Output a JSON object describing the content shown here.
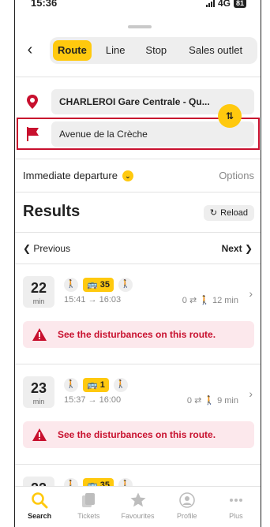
{
  "status": {
    "time": "15:36",
    "network": "4G",
    "battery": "81"
  },
  "nav": {
    "tabs": [
      {
        "label": "Route",
        "active": true
      },
      {
        "label": "Line",
        "active": false
      },
      {
        "label": "Stop",
        "active": false
      },
      {
        "label": "Sales outlet",
        "active": false
      }
    ]
  },
  "journey": {
    "origin": "CHARLEROI Gare Centrale - Qu...",
    "destination": "Avenue de la Crèche",
    "departure_label": "Immediate departure",
    "options_label": "Options"
  },
  "results": {
    "title": "Results",
    "reload_label": "Reload",
    "previous_label": "Previous",
    "next_label": "Next",
    "trips": [
      {
        "minutes": "22",
        "unit": "min",
        "line": "35",
        "times": "15:41 → 16:03",
        "meta": "0 ⇄ 🚶 12 min",
        "alert": "See the disturbances on this route."
      },
      {
        "minutes": "23",
        "unit": "min",
        "line": "1",
        "times": "15:37 → 16:00",
        "meta": "0 ⇄ 🚶 9 min",
        "alert": "See the disturbances on this route."
      },
      {
        "minutes": "22",
        "unit": "min",
        "line": "35"
      }
    ]
  },
  "tabbar": {
    "items": [
      {
        "label": "Search",
        "icon": "search-icon",
        "active": true
      },
      {
        "label": "Tickets",
        "icon": "tickets-icon",
        "active": false
      },
      {
        "label": "Favourites",
        "icon": "star-icon",
        "active": false
      },
      {
        "label": "Profile",
        "icon": "profile-icon",
        "active": false
      },
      {
        "label": "Plus",
        "icon": "more-icon",
        "active": false
      }
    ]
  },
  "colors": {
    "accent": "#ffc90e",
    "alert": "#c8102e",
    "alert_bg": "#fce8ec"
  }
}
